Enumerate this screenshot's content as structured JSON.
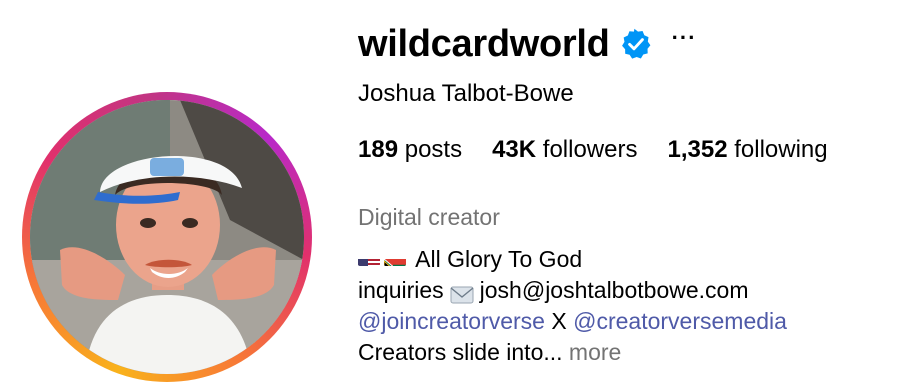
{
  "profile": {
    "username": "wildcardworld",
    "full_name": "Joshua Talbot-Bowe",
    "more_label": "···",
    "icons": {
      "verified": "verified-badge-icon",
      "more": "more-options-icon"
    }
  },
  "stats": [
    {
      "count": "189",
      "label": " posts"
    },
    {
      "count": "43K",
      "label": " followers"
    },
    {
      "count": "1,352",
      "label": " following"
    }
  ],
  "category": "Digital creator",
  "bio": {
    "line1_text": "All Glory To God",
    "line1_flags": [
      "us-flag-icon",
      "south-africa-flag-icon"
    ],
    "line2_prefix": "inquiries",
    "line2_icon": "envelope-icon",
    "line2_email": "josh@joshtalbotbowe.com",
    "mention1": "@joincreatorverse",
    "separator": " X ",
    "mention2": "@creatorversemedia",
    "line4_text": "Creators slide into... ",
    "more_link": "more"
  },
  "colors": {
    "verified_blue": "#0095f6",
    "mention": "#4f5aa8",
    "muted": "#737373",
    "story_ring": [
      "#f9b21b",
      "#e1306c",
      "#b829c9"
    ]
  }
}
